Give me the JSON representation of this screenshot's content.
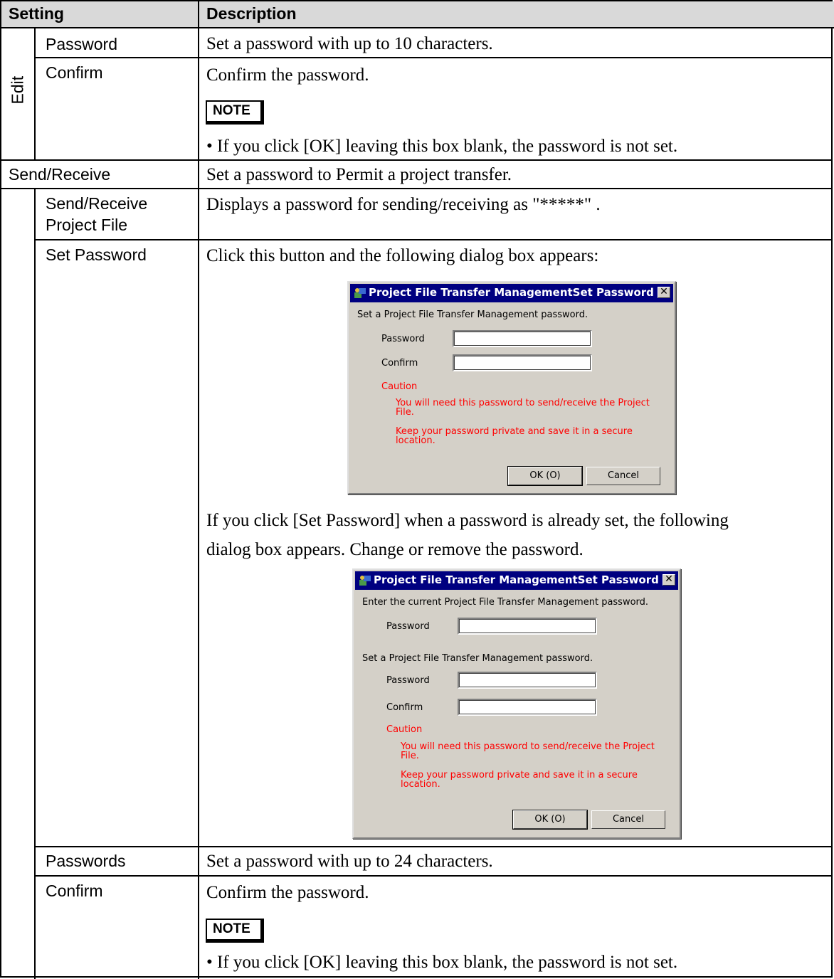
{
  "header": {
    "setting": "Setting",
    "description": "Description"
  },
  "edit_group": {
    "label": "Edit",
    "rows": [
      {
        "setting": "Password",
        "description": "Set a password with up to 10 characters."
      },
      {
        "setting": "Confirm",
        "description": "Confirm the password.",
        "note_label": "NOTE",
        "note": "• If you click [OK] leaving this box blank, the password is not set."
      }
    ]
  },
  "send_receive": {
    "setting": "Send/Receive",
    "description": "Set a password to Permit a project transfer.",
    "rows": [
      {
        "setting_line1": "Send/Receive",
        "setting_line2": "Project File",
        "description": "Displays a password for sending/receiving as \"*****\" ."
      },
      {
        "setting": "Set Password",
        "description": "Click this button and the following dialog box appears:",
        "description2_line1": "If you click [Set Password] when a password is already set, the following",
        "description2_line2": "dialog box appears. Change or remove the password."
      },
      {
        "setting": "Passwords",
        "description": "Set a password with up to 24 characters."
      },
      {
        "setting": "Confirm",
        "description": "Confirm the password.",
        "note_label": "NOTE",
        "note": "• If you click [OK] leaving this box blank, the password is not set."
      }
    ]
  },
  "dialog1": {
    "title": "Project File Transfer ManagementSet Password",
    "close": "✕",
    "instruction": "Set a Project File Transfer Management password.",
    "password_label": "Password",
    "confirm_label": "Confirm",
    "caution_label": "Caution",
    "caution1_line1": "You will need this password to send/receive the Project",
    "caution1_line2": "File.",
    "caution2_line1": "Keep your password private and save it in a secure",
    "caution2_line2": "location.",
    "ok": "OK (O)",
    "cancel": "Cancel"
  },
  "dialog2": {
    "title": "Project File Transfer ManagementSet Password",
    "close": "✕",
    "current_instruction": "Enter the current Project File Transfer Management password.",
    "current_password_label": "Password",
    "instruction": "Set a Project File Transfer Management password.",
    "password_label": "Password",
    "confirm_label": "Confirm",
    "caution_label": "Caution",
    "caution1_line1": "You will need this password to send/receive the Project",
    "caution1_line2": "File.",
    "caution2_line1": "Keep your password private and save it in a secure",
    "caution2_line2": "location.",
    "ok": "OK (O)",
    "cancel": "Cancel"
  }
}
